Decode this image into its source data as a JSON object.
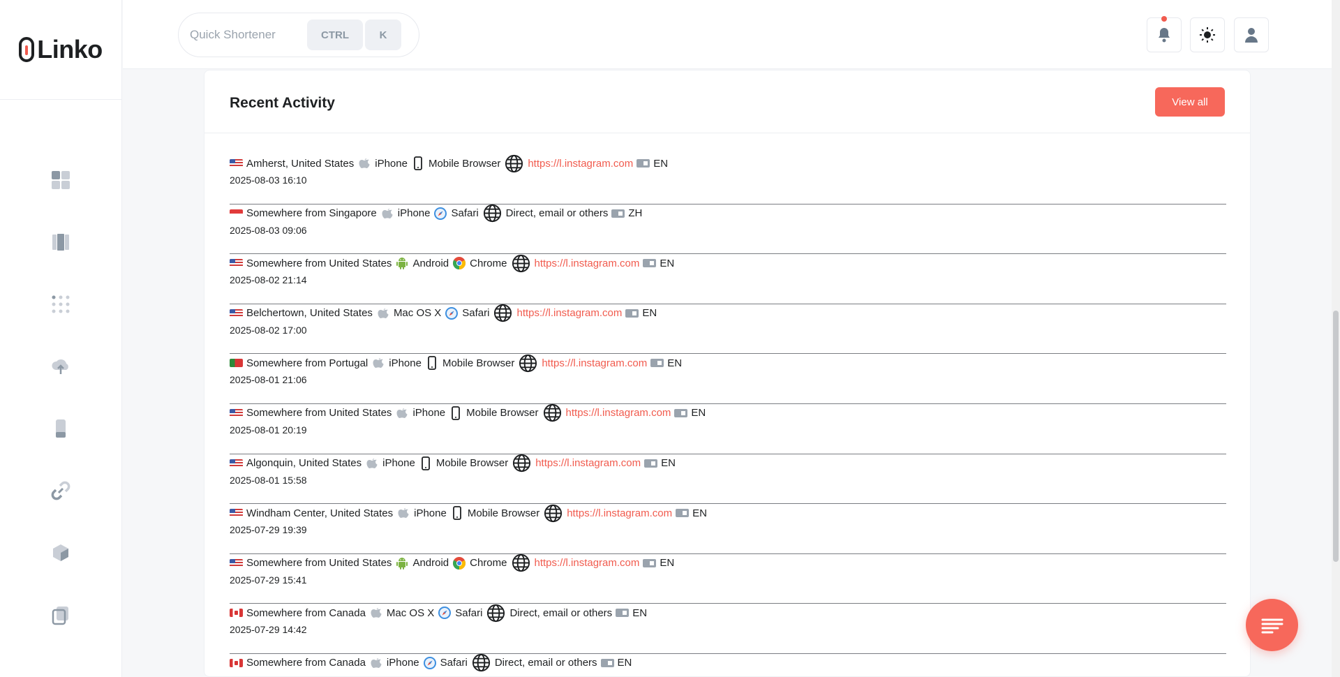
{
  "app": {
    "logo_text": "Linko",
    "accent_color": "#f7685b"
  },
  "header": {
    "quick_placeholder": "Quick Shortener",
    "key_ctrl": "CTRL",
    "key_k": "K",
    "icons": [
      "bell-icon",
      "sun-icon",
      "user-icon"
    ],
    "notification_dot": true
  },
  "sidebar": {
    "icons": [
      "dashboard-icon",
      "pages-icon",
      "apps-grid-icon",
      "cloud-upload-icon",
      "mobile-icon",
      "link-icon",
      "cube-icon",
      "copy-icon",
      "chevron-up-icon"
    ]
  },
  "card": {
    "title": "Recent Activity",
    "view_all_label": "View all"
  },
  "activity": [
    {
      "flag": "us",
      "location": "Amherst, United States",
      "os": "iPhone",
      "os_icon": "apple-icon",
      "browser": "Mobile Browser",
      "browser_icon": "mobile-browser-icon",
      "referrer": "https://l.instagram.com",
      "referrer_is_link": true,
      "lang": "EN",
      "timestamp": "2025-08-03 16:10"
    },
    {
      "flag": "sg",
      "location": "Somewhere from Singapore",
      "os": "iPhone",
      "os_icon": "apple-icon",
      "browser": "Safari",
      "browser_icon": "safari-icon",
      "referrer": "Direct, email or others",
      "referrer_is_link": false,
      "lang": "ZH",
      "timestamp": "2025-08-03 09:06"
    },
    {
      "flag": "us",
      "location": "Somewhere from United States",
      "os": "Android",
      "os_icon": "android-icon",
      "browser": "Chrome",
      "browser_icon": "chrome-icon",
      "referrer": "https://l.instagram.com",
      "referrer_is_link": true,
      "lang": "EN",
      "timestamp": "2025-08-02 21:14"
    },
    {
      "flag": "us",
      "location": "Belchertown, United States",
      "os": "Mac OS X",
      "os_icon": "apple-icon",
      "browser": "Safari",
      "browser_icon": "safari-icon",
      "referrer": "https://l.instagram.com",
      "referrer_is_link": true,
      "lang": "EN",
      "timestamp": "2025-08-02 17:00"
    },
    {
      "flag": "pt",
      "location": "Somewhere from Portugal",
      "os": "iPhone",
      "os_icon": "apple-icon",
      "browser": "Mobile Browser",
      "browser_icon": "mobile-browser-icon",
      "referrer": "https://l.instagram.com",
      "referrer_is_link": true,
      "lang": "EN",
      "timestamp": "2025-08-01 21:06"
    },
    {
      "flag": "us",
      "location": "Somewhere from United States",
      "os": "iPhone",
      "os_icon": "apple-icon",
      "browser": "Mobile Browser",
      "browser_icon": "mobile-browser-icon",
      "referrer": "https://l.instagram.com",
      "referrer_is_link": true,
      "lang": "EN",
      "timestamp": "2025-08-01 20:19"
    },
    {
      "flag": "us",
      "location": "Algonquin, United States",
      "os": "iPhone",
      "os_icon": "apple-icon",
      "browser": "Mobile Browser",
      "browser_icon": "mobile-browser-icon",
      "referrer": "https://l.instagram.com",
      "referrer_is_link": true,
      "lang": "EN",
      "timestamp": "2025-08-01 15:58"
    },
    {
      "flag": "us",
      "location": "Windham Center, United States",
      "os": "iPhone",
      "os_icon": "apple-icon",
      "browser": "Mobile Browser",
      "browser_icon": "mobile-browser-icon",
      "referrer": "https://l.instagram.com",
      "referrer_is_link": true,
      "lang": "EN",
      "timestamp": "2025-07-29 19:39"
    },
    {
      "flag": "us",
      "location": "Somewhere from United States",
      "os": "Android",
      "os_icon": "android-icon",
      "browser": "Chrome",
      "browser_icon": "chrome-icon",
      "referrer": "https://l.instagram.com",
      "referrer_is_link": true,
      "lang": "EN",
      "timestamp": "2025-07-29 15:41"
    },
    {
      "flag": "ca",
      "location": "Somewhere from Canada",
      "os": "Mac OS X",
      "os_icon": "apple-icon",
      "browser": "Safari",
      "browser_icon": "safari-icon",
      "referrer": "Direct, email or others",
      "referrer_is_link": false,
      "lang": "EN",
      "timestamp": "2025-07-29 14:42"
    },
    {
      "flag": "ca",
      "location": "Somewhere from Canada",
      "os": "iPhone",
      "os_icon": "apple-icon",
      "browser": "Safari",
      "browser_icon": "safari-icon",
      "referrer": "Direct, email or others",
      "referrer_is_link": false,
      "lang": "EN",
      "timestamp": ""
    }
  ],
  "fab_icon": "menu-lines-icon"
}
